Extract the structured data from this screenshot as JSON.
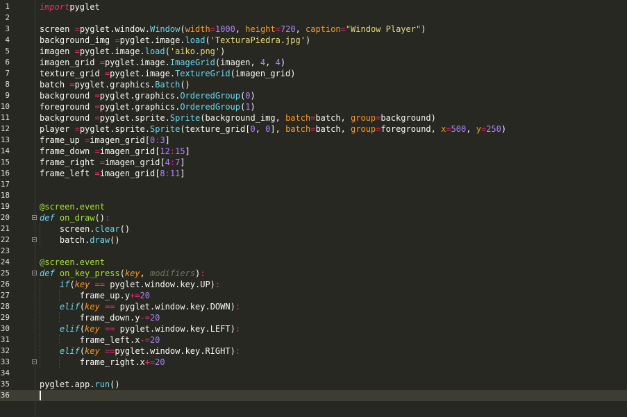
{
  "editor": {
    "current_line": 36,
    "lines": [
      {
        "n": "1",
        "tokens": [
          [
            "kwi",
            "import"
          ],
          [
            "",
            "pyglet"
          ]
        ]
      },
      {
        "n": "2",
        "tokens": []
      },
      {
        "n": "3",
        "tokens": [
          [
            "",
            "screen "
          ],
          [
            "op",
            "="
          ],
          [
            "",
            "pyglet.window."
          ],
          [
            "fn",
            "Window"
          ],
          [
            "",
            "("
          ],
          [
            "kwarg",
            "width"
          ],
          [
            "op",
            "="
          ],
          [
            "num",
            "1000"
          ],
          [
            "",
            ", "
          ],
          [
            "kwarg",
            "height"
          ],
          [
            "op",
            "="
          ],
          [
            "num",
            "720"
          ],
          [
            "",
            ", "
          ],
          [
            "kwarg",
            "caption"
          ],
          [
            "op",
            "="
          ],
          [
            "str",
            "\"Window Player\""
          ],
          [
            "",
            ")"
          ]
        ]
      },
      {
        "n": "4",
        "tokens": [
          [
            "",
            "background_img "
          ],
          [
            "op",
            "="
          ],
          [
            "",
            "pyglet.image."
          ],
          [
            "fn",
            "load"
          ],
          [
            "",
            "("
          ],
          [
            "str",
            "'TexturaPiedra.jpg'"
          ],
          [
            "",
            ")"
          ]
        ]
      },
      {
        "n": "5",
        "tokens": [
          [
            "",
            "imagen "
          ],
          [
            "op",
            "="
          ],
          [
            "",
            "pyglet.image."
          ],
          [
            "fn",
            "load"
          ],
          [
            "",
            "("
          ],
          [
            "str",
            "'aiko.png'"
          ],
          [
            "",
            ")"
          ]
        ]
      },
      {
        "n": "6",
        "tokens": [
          [
            "",
            "imagen_grid "
          ],
          [
            "op",
            "="
          ],
          [
            "",
            "pyglet.image."
          ],
          [
            "fn",
            "ImageGrid"
          ],
          [
            "",
            "(imagen, "
          ],
          [
            "num",
            "4"
          ],
          [
            "",
            ", "
          ],
          [
            "num",
            "4"
          ],
          [
            "",
            ")"
          ]
        ]
      },
      {
        "n": "7",
        "tokens": [
          [
            "",
            "texture_grid "
          ],
          [
            "op",
            "="
          ],
          [
            "",
            "pyglet.image."
          ],
          [
            "fn",
            "TextureGrid"
          ],
          [
            "",
            "(imagen_grid)"
          ]
        ]
      },
      {
        "n": "8",
        "tokens": [
          [
            "",
            "batch "
          ],
          [
            "op",
            "="
          ],
          [
            "",
            "pyglet.graphics."
          ],
          [
            "fn",
            "Batch"
          ],
          [
            "",
            "()"
          ]
        ]
      },
      {
        "n": "9",
        "tokens": [
          [
            "",
            "background "
          ],
          [
            "op",
            "="
          ],
          [
            "",
            "pyglet.graphics."
          ],
          [
            "fn",
            "OrderedGroup"
          ],
          [
            "",
            "("
          ],
          [
            "num",
            "0"
          ],
          [
            "",
            ")"
          ]
        ]
      },
      {
        "n": "10",
        "tokens": [
          [
            "",
            "foreground "
          ],
          [
            "op",
            "="
          ],
          [
            "",
            "pyglet.graphics."
          ],
          [
            "fn",
            "OrderedGroup"
          ],
          [
            "",
            "("
          ],
          [
            "num",
            "1"
          ],
          [
            "",
            ")"
          ]
        ]
      },
      {
        "n": "11",
        "tokens": [
          [
            "",
            "background "
          ],
          [
            "op",
            "="
          ],
          [
            "",
            "pyglet.sprite."
          ],
          [
            "fn",
            "Sprite"
          ],
          [
            "",
            "(background_img, "
          ],
          [
            "kwarg",
            "batch"
          ],
          [
            "op",
            "="
          ],
          [
            "",
            "batch, "
          ],
          [
            "kwarg",
            "group"
          ],
          [
            "op",
            "="
          ],
          [
            "",
            "background)"
          ]
        ]
      },
      {
        "n": "12",
        "tokens": [
          [
            "",
            "player "
          ],
          [
            "op",
            "="
          ],
          [
            "",
            "pyglet.sprite."
          ],
          [
            "fn",
            "Sprite"
          ],
          [
            "",
            "(texture_grid["
          ],
          [
            "num",
            "0"
          ],
          [
            "",
            ", "
          ],
          [
            "num",
            "0"
          ],
          [
            "",
            "], "
          ],
          [
            "kwarg",
            "batch"
          ],
          [
            "op",
            "="
          ],
          [
            "",
            "batch, "
          ],
          [
            "kwarg",
            "group"
          ],
          [
            "op",
            "="
          ],
          [
            "",
            "foreground, "
          ],
          [
            "kwarg",
            "x"
          ],
          [
            "op",
            "="
          ],
          [
            "num",
            "500"
          ],
          [
            "",
            ", "
          ],
          [
            "kwarg",
            "y"
          ],
          [
            "op",
            "="
          ],
          [
            "num",
            "250"
          ],
          [
            "",
            ")"
          ]
        ]
      },
      {
        "n": "13",
        "tokens": [
          [
            "",
            "frame_up "
          ],
          [
            "op",
            "="
          ],
          [
            "",
            "imagen_grid["
          ],
          [
            "num",
            "0"
          ],
          [
            "op",
            ":"
          ],
          [
            "num",
            "3"
          ],
          [
            "",
            "]"
          ]
        ]
      },
      {
        "n": "14",
        "tokens": [
          [
            "",
            "frame_down "
          ],
          [
            "op",
            "="
          ],
          [
            "",
            "imagen_grid["
          ],
          [
            "num",
            "12"
          ],
          [
            "op",
            ":"
          ],
          [
            "num",
            "15"
          ],
          [
            "",
            "]"
          ]
        ]
      },
      {
        "n": "15",
        "tokens": [
          [
            "",
            "frame_right "
          ],
          [
            "op",
            "="
          ],
          [
            "",
            "imagen_grid["
          ],
          [
            "num",
            "4"
          ],
          [
            "op",
            ":"
          ],
          [
            "num",
            "7"
          ],
          [
            "",
            "]"
          ]
        ]
      },
      {
        "n": "16",
        "tokens": [
          [
            "",
            "frame_left "
          ],
          [
            "op",
            "="
          ],
          [
            "",
            "imagen_grid["
          ],
          [
            "num",
            "8"
          ],
          [
            "op",
            ":"
          ],
          [
            "num",
            "11"
          ],
          [
            "",
            "]"
          ]
        ]
      },
      {
        "n": "17",
        "tokens": []
      },
      {
        "n": "18",
        "tokens": []
      },
      {
        "n": "19",
        "tokens": [
          [
            "deco",
            "@screen.event"
          ]
        ]
      },
      {
        "n": "20",
        "tokens": [
          [
            "kw",
            "def"
          ],
          [
            "",
            " "
          ],
          [
            "def",
            "on_draw"
          ],
          [
            "",
            "()"
          ],
          [
            "op",
            ":"
          ]
        ]
      },
      {
        "n": "21",
        "tokens": [
          [
            "",
            "    screen."
          ],
          [
            "fn",
            "clear"
          ],
          [
            "",
            "()"
          ]
        ]
      },
      {
        "n": "22",
        "tokens": [
          [
            "",
            "    batch."
          ],
          [
            "fn",
            "draw"
          ],
          [
            "",
            "()"
          ]
        ]
      },
      {
        "n": "23",
        "tokens": []
      },
      {
        "n": "24",
        "tokens": [
          [
            "deco",
            "@screen.event"
          ]
        ]
      },
      {
        "n": "25",
        "tokens": [
          [
            "kw",
            "def"
          ],
          [
            "",
            " "
          ],
          [
            "def",
            "on_key_press"
          ],
          [
            "",
            "("
          ],
          [
            "param",
            "key"
          ],
          [
            "",
            ", "
          ],
          [
            "param-dim",
            "modifiers"
          ],
          [
            "",
            ")"
          ],
          [
            "op",
            ":"
          ]
        ]
      },
      {
        "n": "26",
        "tokens": [
          [
            "",
            "    "
          ],
          [
            "kw",
            "if"
          ],
          [
            "",
            "("
          ],
          [
            "param",
            "key"
          ],
          [
            "",
            " "
          ],
          [
            "op",
            "=="
          ],
          [
            "",
            " pyglet.window.key.UP)"
          ],
          [
            "op",
            ":"
          ]
        ]
      },
      {
        "n": "27",
        "tokens": [
          [
            "",
            "        frame_up.y"
          ],
          [
            "op",
            "+="
          ],
          [
            "num",
            "20"
          ]
        ]
      },
      {
        "n": "28",
        "tokens": [
          [
            "",
            "    "
          ],
          [
            "kw",
            "elif"
          ],
          [
            "",
            "("
          ],
          [
            "param",
            "key"
          ],
          [
            "",
            " "
          ],
          [
            "op",
            "=="
          ],
          [
            "",
            " pyglet.window.key.DOWN)"
          ],
          [
            "op",
            ":"
          ]
        ]
      },
      {
        "n": "29",
        "tokens": [
          [
            "",
            "        frame_down.y"
          ],
          [
            "op",
            "-="
          ],
          [
            "num",
            "20"
          ]
        ]
      },
      {
        "n": "30",
        "tokens": [
          [
            "",
            "    "
          ],
          [
            "kw",
            "elif"
          ],
          [
            "",
            "("
          ],
          [
            "param",
            "key"
          ],
          [
            "",
            " "
          ],
          [
            "op",
            "=="
          ],
          [
            "",
            " pyglet.window.key.LEFT)"
          ],
          [
            "op",
            ":"
          ]
        ]
      },
      {
        "n": "31",
        "tokens": [
          [
            "",
            "        frame_left.x"
          ],
          [
            "op",
            "-="
          ],
          [
            "num",
            "20"
          ]
        ]
      },
      {
        "n": "32",
        "tokens": [
          [
            "",
            "    "
          ],
          [
            "kw",
            "elif"
          ],
          [
            "",
            "("
          ],
          [
            "param",
            "key"
          ],
          [
            "",
            " "
          ],
          [
            "op",
            "=="
          ],
          [
            "",
            "pyglet.window.key.RIGHT)"
          ],
          [
            "op",
            ":"
          ]
        ]
      },
      {
        "n": "33",
        "tokens": [
          [
            "",
            "        frame_right.x"
          ],
          [
            "op",
            "+="
          ],
          [
            "num",
            "20"
          ]
        ]
      },
      {
        "n": "34",
        "tokens": []
      },
      {
        "n": "35",
        "tokens": [
          [
            "",
            "pyglet.app."
          ],
          [
            "fn",
            "run"
          ],
          [
            "",
            "()"
          ]
        ]
      },
      {
        "n": "36",
        "tokens": []
      }
    ]
  }
}
